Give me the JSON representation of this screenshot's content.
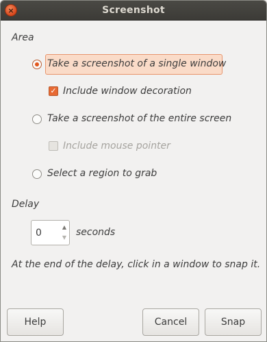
{
  "window": {
    "title": "Screenshot",
    "close_glyph": "×"
  },
  "area": {
    "label": "Area",
    "options": [
      {
        "label": "Take a screenshot of a single window",
        "selected": true
      },
      {
        "label": "Take a screenshot of the entire screen",
        "selected": false
      },
      {
        "label": "Select a region to grab",
        "selected": false
      }
    ],
    "include_decoration": {
      "label": "Include window decoration",
      "checked": true,
      "check_glyph": "✓"
    },
    "include_pointer": {
      "label": "Include mouse pointer",
      "checked": false,
      "enabled": false
    }
  },
  "delay": {
    "label": "Delay",
    "value": "0",
    "unit": "seconds",
    "up_glyph": "▲",
    "down_glyph": "▼"
  },
  "hint": "At the end of the delay, click in a window to snap it.",
  "buttons": {
    "help": "Help",
    "cancel": "Cancel",
    "snap": "Snap"
  },
  "colors": {
    "accent": "#e2561c",
    "selection_bg": "#fadbc8",
    "titlebar": "#3c3b37"
  }
}
